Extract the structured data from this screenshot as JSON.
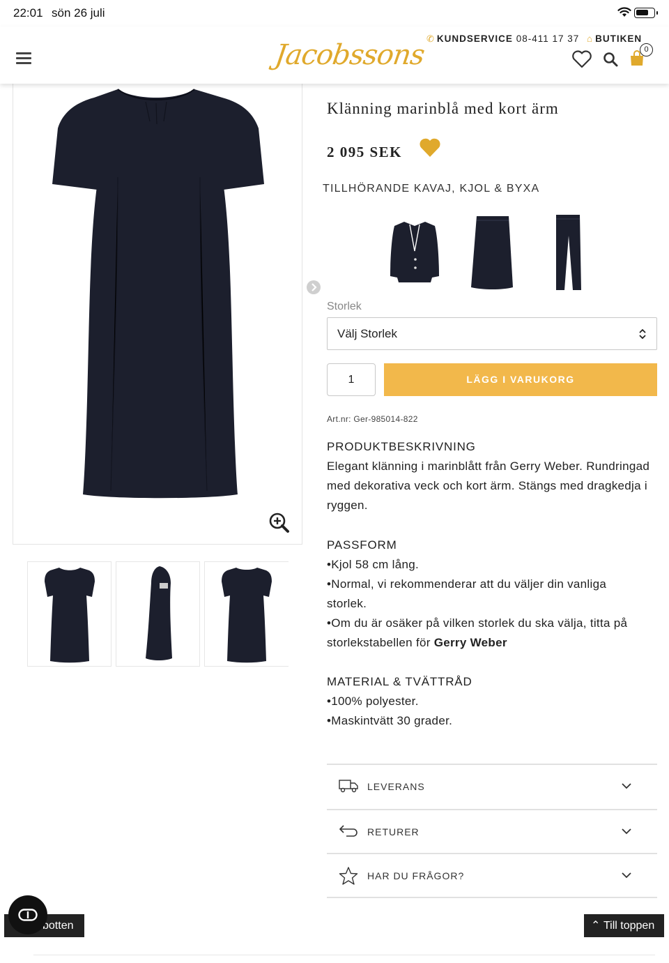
{
  "status_bar": {
    "time": "22:01",
    "date": "sön 26 juli"
  },
  "header": {
    "logo_text": "Jacobssons",
    "kundservice_label": "KUNDSERVICE",
    "kundservice_phone": "08-411 17 37",
    "butiken_label": "BUTIKEN",
    "cart_count": "0",
    "accent_color": "#e0a92c"
  },
  "product": {
    "brand": "GERRY WEBER",
    "title": "Klänning marinblå med kort ärm",
    "price": "2 095 SEK",
    "matching_label": "TILLHÖRANDE KAVAJ, KJOL & BYXA",
    "matching_items": [
      "blazer-image",
      "skirt-image",
      "trousers-image"
    ],
    "size_label": "Storlek",
    "size_select_value": "Välj Storlek",
    "quantity": "1",
    "add_to_cart": "LÄGG I VARUKORG",
    "art_nr": "Art.nr: Ger-985014-822",
    "dress_color": "#1c1f2d",
    "button_color": "#f2b84b"
  },
  "description": {
    "heading": "PRODUKTBESKRIVNING",
    "text": "Elegant klänning i marinblått från Gerry Weber. Rundringad med dekorativa veck och kort ärm. Stängs med dragkedja i ryggen."
  },
  "fit": {
    "heading": "PASSFORM",
    "bullets": [
      "Kjol 58 cm lång.",
      "Normal, vi rekommenderar att du väljer din vanliga storlek.",
      "Om du är osäker på vilken storlek du ska välja, titta på storlekstabellen för"
    ],
    "brand_link": "Gerry Weber"
  },
  "material": {
    "heading": "MATERIAL & TVÄTTRÅD",
    "bullets": [
      "100% polyester.",
      "Maskintvätt 30 grader."
    ]
  },
  "accordions": [
    {
      "label": "LEVERANS",
      "icon": "truck-icon"
    },
    {
      "label": "RETURER",
      "icon": "return-arrow-icon"
    },
    {
      "label": "HAR DU FRÅGOR?",
      "icon": "star-icon"
    }
  ],
  "footer_buttons": {
    "to_bottom": "botten",
    "to_top": "Till toppen"
  }
}
